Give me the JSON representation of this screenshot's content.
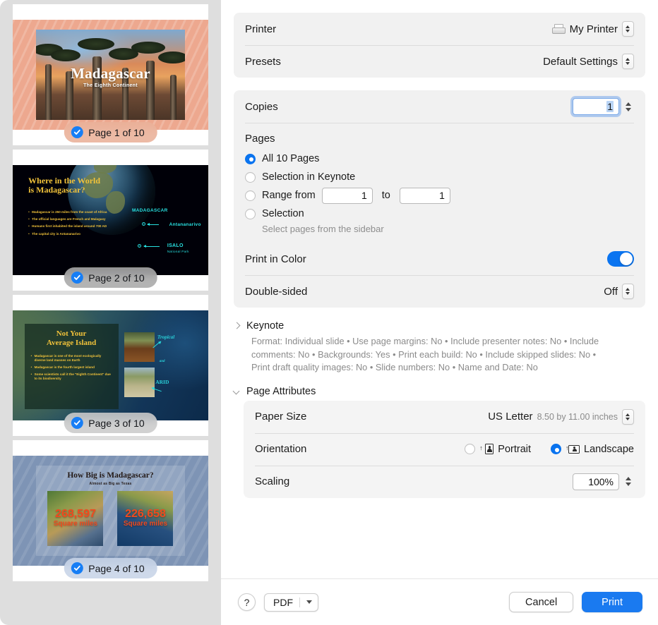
{
  "sidebar": {
    "slides": [
      {
        "badge": "Page 1 of 10",
        "title": "Madagascar",
        "subtitle": "The Eighth Continent"
      },
      {
        "badge": "Page 2 of 10",
        "title_line1": "Where in the World",
        "title_line2": "is Madagascar?",
        "bullets": [
          "Madagascar is 250 miles from the coast of Africa",
          "The official languages are French and Malagasy",
          "Humans first inhabited the island around 700 AD",
          "The capital city is Antananarivo"
        ],
        "map_labels": {
          "country": "MADAGASCAR",
          "capital": "Antananarivo",
          "park": "ISALO",
          "park_sub": "National Park"
        }
      },
      {
        "badge": "Page 3 of 10",
        "title_line1": "Not Your",
        "title_line2": "Average Island",
        "bullets": [
          "Madagascar is one of the most ecologically diverse land masses on Earth",
          "Madagascar is the fourth largest island",
          "Some scientists call it the \"Eighth Continent\" due to its biodiversity"
        ],
        "annotations": [
          "Tropical",
          "and",
          "ARID"
        ]
      },
      {
        "badge": "Page 4 of 10",
        "title": "How Big is Madagascar?",
        "subtitle": "Almost as Big as Texas",
        "stats": [
          {
            "number": "268,597",
            "unit": "Square miles"
          },
          {
            "number": "226,658",
            "unit": "Square miles"
          }
        ]
      }
    ]
  },
  "settings": {
    "printer": {
      "label": "Printer",
      "value": "My Printer"
    },
    "presets": {
      "label": "Presets",
      "value": "Default Settings"
    },
    "copies": {
      "label": "Copies",
      "value": "1"
    },
    "pages": {
      "label": "Pages",
      "options": [
        {
          "label": "All 10 Pages",
          "selected": true
        },
        {
          "label": "Selection in Keynote",
          "selected": false
        },
        {
          "label": "Range from",
          "selected": false
        },
        {
          "label": "Selection",
          "selected": false
        }
      ],
      "range_from": "1",
      "range_to": "1",
      "to_label": "to",
      "selection_hint": "Select pages from the sidebar"
    },
    "print_in_color": {
      "label": "Print in Color",
      "state": "on"
    },
    "double_sided": {
      "label": "Double-sided",
      "value": "Off"
    }
  },
  "keynote_section": {
    "title": "Keynote",
    "summary": "Format: Individual slide • Use page margins: No • Include presenter notes: No • Include comments: No • Backgrounds: Yes • Print each build: No • Include skipped slides: No • Print draft quality images: No • Slide numbers: No • Name and Date: No"
  },
  "page_attributes": {
    "title": "Page Attributes",
    "paper_size": {
      "label": "Paper Size",
      "value": "US Letter",
      "dimensions": "8.50 by 11.00 inches"
    },
    "orientation": {
      "label": "Orientation",
      "portrait": "Portrait",
      "landscape": "Landscape",
      "selected": "landscape"
    },
    "scaling": {
      "label": "Scaling",
      "value": "100%"
    }
  },
  "footer": {
    "help": "?",
    "pdf": "PDF",
    "cancel": "Cancel",
    "print": "Print"
  },
  "colors": {
    "accent": "#0a74f0",
    "print_button": "#1a7af0",
    "sidebar_bg": "#dedede",
    "group_bg": "#f1f1f1"
  }
}
